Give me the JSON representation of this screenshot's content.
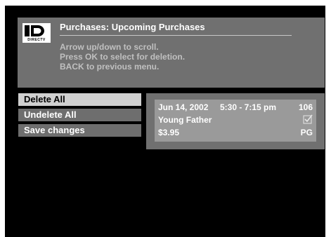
{
  "header": {
    "logo_text": "DIRECTV",
    "title": "Purchases: Upcoming Purchases",
    "instructions": [
      "Arrow up/down to scroll.",
      "Press OK to select for deletion.",
      "BACK to previous menu."
    ]
  },
  "menu": {
    "items": [
      {
        "label": "Delete All",
        "selected": true
      },
      {
        "label": "Undelete All",
        "selected": false
      },
      {
        "label": "Save changes",
        "selected": false
      }
    ]
  },
  "purchases": [
    {
      "date": "Jun 14, 2002",
      "time": "5:30 - 7:15 pm",
      "channel": "106",
      "title": "Young Father",
      "price": "$3.95",
      "rating": "PG",
      "marked_for_deletion": true,
      "check_icon": "checkbox-checked-icon"
    }
  ],
  "colors": {
    "screen_bg": "#000000",
    "panel_gray": "#707070",
    "entry_gray": "#9a9a9a",
    "selected_bg": "#d0d0d0"
  }
}
